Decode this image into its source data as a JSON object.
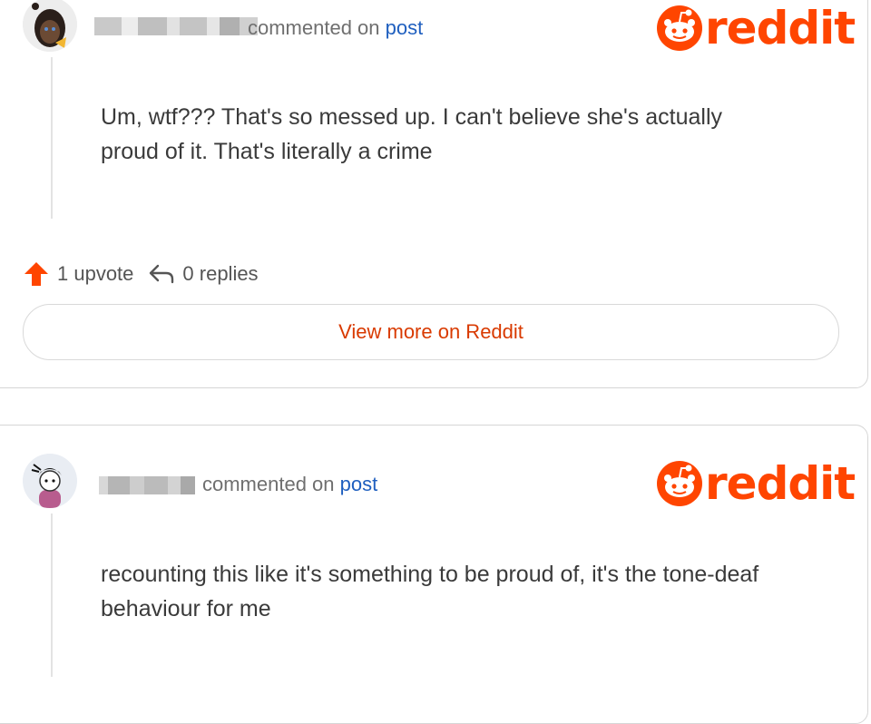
{
  "colors": {
    "brand": "#ff4500",
    "link": "#1f5fbf",
    "text": "#3a3a3a",
    "muted": "#6f6f6f",
    "view_more": "#d93a00"
  },
  "comments": [
    {
      "commented_on": "commented on",
      "post_link": "post",
      "brand": "reddit",
      "body": "Um, wtf??? That's so messed up. I can't believe she's actually proud of it. That's literally a crime",
      "upvotes": "1 upvote",
      "replies": "0 replies",
      "view_more": "View more on Reddit",
      "icons": [
        "avatar",
        "reddit-logo-icon",
        "upvote-arrow-icon",
        "reply-icon"
      ]
    },
    {
      "commented_on": "commented on",
      "post_link": "post",
      "brand": "reddit",
      "body": "recounting this like it's something to be proud of, it's the tone-deaf behaviour for me",
      "icons": [
        "avatar",
        "reddit-logo-icon"
      ]
    }
  ]
}
